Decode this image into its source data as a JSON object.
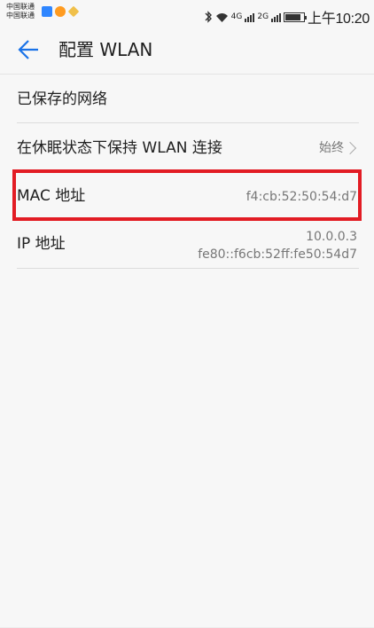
{
  "status_bar": {
    "carrier_line_1": "中国联通",
    "carrier_line_2": "中国联通",
    "network_1": "4G",
    "network_2": "2G",
    "time": "上午10:20",
    "battery_level": 0.88,
    "icons": [
      "message-icon",
      "weibo-icon",
      "favorite-icon",
      "bluetooth-icon",
      "wifi-icon",
      "signal-icon",
      "battery-icon"
    ]
  },
  "header": {
    "title": "配置 WLAN",
    "back_icon": "arrow-back-icon"
  },
  "settings": {
    "saved_networks": "已保存的网络",
    "keep_wlan_on_label": "在休眠状态下保持 WLAN 连接",
    "keep_wlan_on_value": "始终",
    "mac_label": "MAC 地址",
    "mac_value": "f4:cb:52:50:54:d7",
    "ip_label": "IP 地址",
    "ipv4": "10.0.0.3",
    "ipv6": "fe80::f6cb:52ff:fe50:54d7"
  },
  "colors": {
    "accent": "#1a73e8",
    "highlight": "#e21c24",
    "background": "#f7f7f7"
  }
}
